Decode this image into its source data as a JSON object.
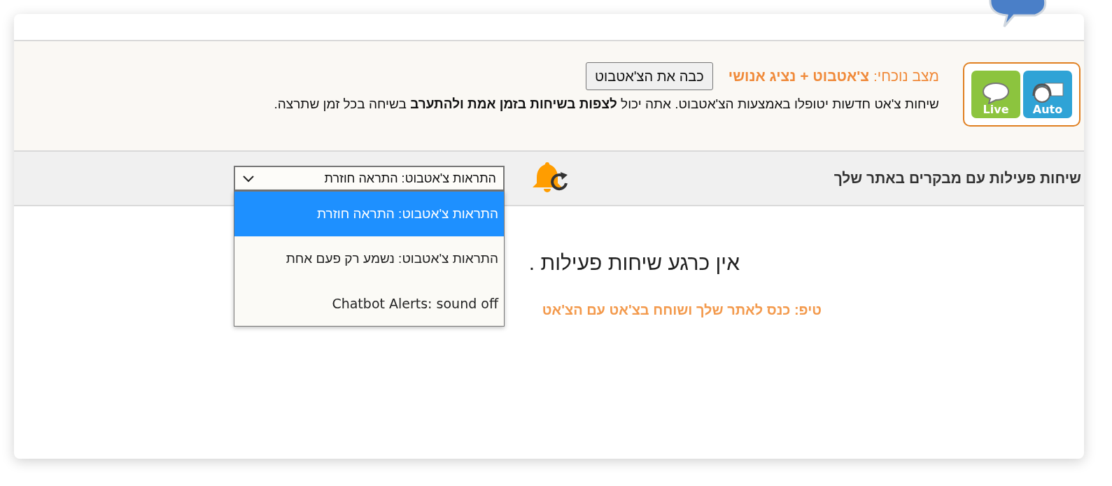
{
  "status_panel": {
    "mode_label": "מצב נוכחי:",
    "mode_value": "צ'אטבוט + נציג אנושי",
    "toggle_button": "כבה את הצ'אטבוט",
    "description": "שיחות צ'אט חדשות יטופלו באמצעות הצ'אטבוט. אתה יכול **לצפות בשיחות בזמן אמת ולהתערב** בשיחה בכל זמן שתרצה.",
    "logo_tiles": [
      {
        "kind": "auto",
        "label": "Auto"
      },
      {
        "kind": "live",
        "label": "Live"
      }
    ]
  },
  "header": {
    "title": "שיחות פעילות עם מבקרים באתר שלך",
    "alert_select": {
      "value": "התראות צ'אטבוט: התראה חוזרת",
      "expanded": true,
      "options": [
        {
          "label": "התראות צ'אטבוט: התראה חוזרת",
          "selected": true
        },
        {
          "label": "התראות צ'אטבוט: נשמע רק פעם אחת",
          "selected": false
        },
        {
          "label": "Chatbot Alerts: sound off",
          "selected": false
        }
      ]
    }
  },
  "content": {
    "empty_message": "אין כרגע שיחות פעילות .",
    "tip": "טיפ: כנס לאתר שלך ושוחח בצ'אט עם הצ'אט"
  }
}
